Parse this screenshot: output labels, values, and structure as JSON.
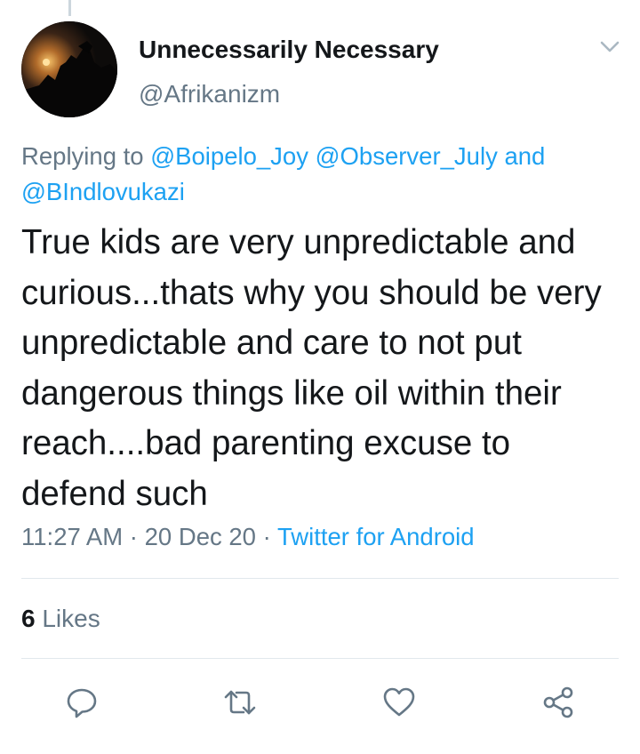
{
  "tweet": {
    "author": {
      "display_name": "Unnecessarily Necessary",
      "handle": "@Afrikanizm"
    },
    "replying_to": {
      "prefix": "Replying to",
      "mention_1": "@Boipelo_Joy",
      "mention_2": "@Observer_July",
      "and_label": "and",
      "mention_3": "@BIndlovukazi"
    },
    "text": "True kids are very unpredictable and curious...thats why you should be very unpredictable and care to not put dangerous things like oil within their reach....bad parenting excuse to defend such",
    "time": "11:27 AM",
    "separator": "·",
    "date": "20 Dec 20",
    "source": "Twitter for Android",
    "likes_count": "6",
    "likes_label": "Likes"
  },
  "actions": [
    {
      "icon": "reply-icon"
    },
    {
      "icon": "retweet-icon"
    },
    {
      "icon": "like-icon"
    },
    {
      "icon": "share-icon"
    }
  ],
  "colors": {
    "text": "#14171a",
    "secondary": "#657786",
    "accent": "#1da1f2",
    "divider": "#e1e8ed"
  }
}
